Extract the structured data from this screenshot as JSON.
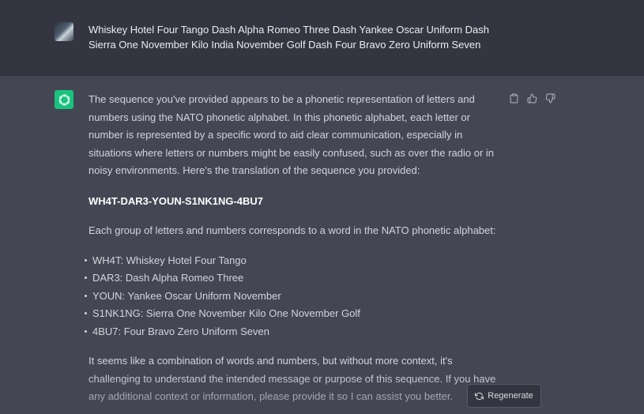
{
  "user_message": {
    "avatar_icon": "user-avatar-photo",
    "text_line1": "Whiskey Hotel Four Tango Dash Alpha Romeo Three Dash Yankee Oscar Uniform Dash",
    "text_line2": "Sierra One November Kilo India November Golf Dash Four Bravo Zero Uniform Seven"
  },
  "assistant_message": {
    "avatar_icon": "openai-logo-icon",
    "avatar_color": "#19c37d",
    "intro": "The sequence you've provided appears to be a phonetic representation of letters and numbers using the NATO phonetic alphabet. In this phonetic alphabet, each letter or number is represented by a specific word to aid clear communication, especially in situations where letters or numbers might be easily confused, such as over the radio or in noisy environments. Here's the translation of the sequence you provided:",
    "decoded": "WH4T-DAR3-YOUN-S1NK1NG-4BU7",
    "each_group": "Each group of letters and numbers corresponds to a word in the NATO phonetic alphabet:",
    "groups": [
      "WH4T: Whiskey Hotel Four Tango",
      "DAR3: Dash Alpha Romeo Three",
      "YOUN: Yankee Oscar Uniform November",
      "S1NK1NG: Sierra One November Kilo One November Golf",
      "4BU7: Four Bravo Zero Uniform Seven"
    ],
    "closing": "It seems like a combination of words and numbers, but without more context, it's challenging to understand the intended message or purpose of this sequence. If you have any additional context or information, please provide it so I can assist you better."
  },
  "actions": {
    "copy_icon": "clipboard-icon",
    "like_icon": "thumbs-up-icon",
    "dislike_icon": "thumbs-down-icon"
  },
  "regenerate": {
    "icon": "refresh-icon",
    "label": "Regenerate"
  }
}
